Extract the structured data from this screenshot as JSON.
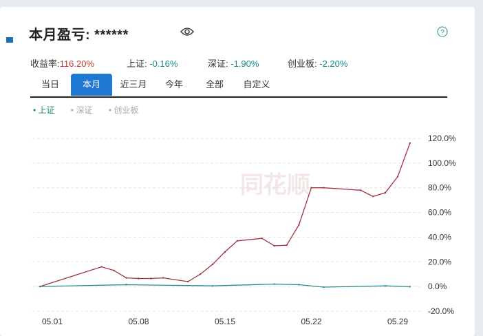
{
  "header": {
    "title": "本月盈亏:",
    "masked_value": "******"
  },
  "stats": {
    "yield_label": "收益率:",
    "yield_value": "116.20%",
    "sh_label": "上证:",
    "sh_value": "-0.16%",
    "sz_label": "深证:",
    "sz_value": "-1.90%",
    "cyb_label": "创业板:",
    "cyb_value": "-2.20%"
  },
  "tabs": [
    "当日",
    "本月",
    "近三月",
    "今年",
    "全部",
    "自定义"
  ],
  "active_tab": "本月",
  "legend": [
    "上证",
    "深证",
    "创业板"
  ],
  "watermark": "同花顺",
  "icons": {
    "eye": "eye-icon",
    "help": "question-circle-icon"
  },
  "colors": {
    "accent": "#1f78d1",
    "profit_line": "#a0323c",
    "index_line": "#2a8a8a",
    "positive": "#c0392b",
    "negative": "#1a8a8a"
  },
  "chart_data": {
    "type": "line",
    "x_tick_labels": [
      "05.01",
      "05.08",
      "05.15",
      "05.22",
      "05.29"
    ],
    "y_tick_labels": [
      "120.0%",
      "100.0%",
      "80.0%",
      "60.0%",
      "40.0%",
      "20.0%",
      "0.0%",
      "-20.0%"
    ],
    "ylim": [
      -20,
      120
    ],
    "grid": true,
    "series": [
      {
        "name": "",
        "x": [
          "05.01",
          "05.06",
          "05.07",
          "05.08",
          "05.09",
          "05.10",
          "05.11",
          "05.13",
          "05.14",
          "05.15",
          "05.16",
          "05.17",
          "05.19",
          "05.20",
          "05.21",
          "05.22",
          "05.23",
          "05.24",
          "05.27",
          "05.28",
          "05.29",
          "05.30",
          "05.31"
        ],
        "values": [
          0,
          16,
          13,
          7,
          6.5,
          6.5,
          7,
          4,
          10,
          18,
          28,
          37,
          39,
          33,
          33.5,
          50,
          80,
          80,
          78,
          73,
          76,
          89,
          116.2
        ]
      },
      {
        "name": "上证",
        "x": [
          "05.01",
          "05.08",
          "05.15",
          "05.20",
          "05.22",
          "05.24",
          "05.29",
          "05.31"
        ],
        "values": [
          0,
          1.5,
          0.5,
          2,
          1.5,
          -0.5,
          0.5,
          -0.16
        ]
      }
    ]
  }
}
